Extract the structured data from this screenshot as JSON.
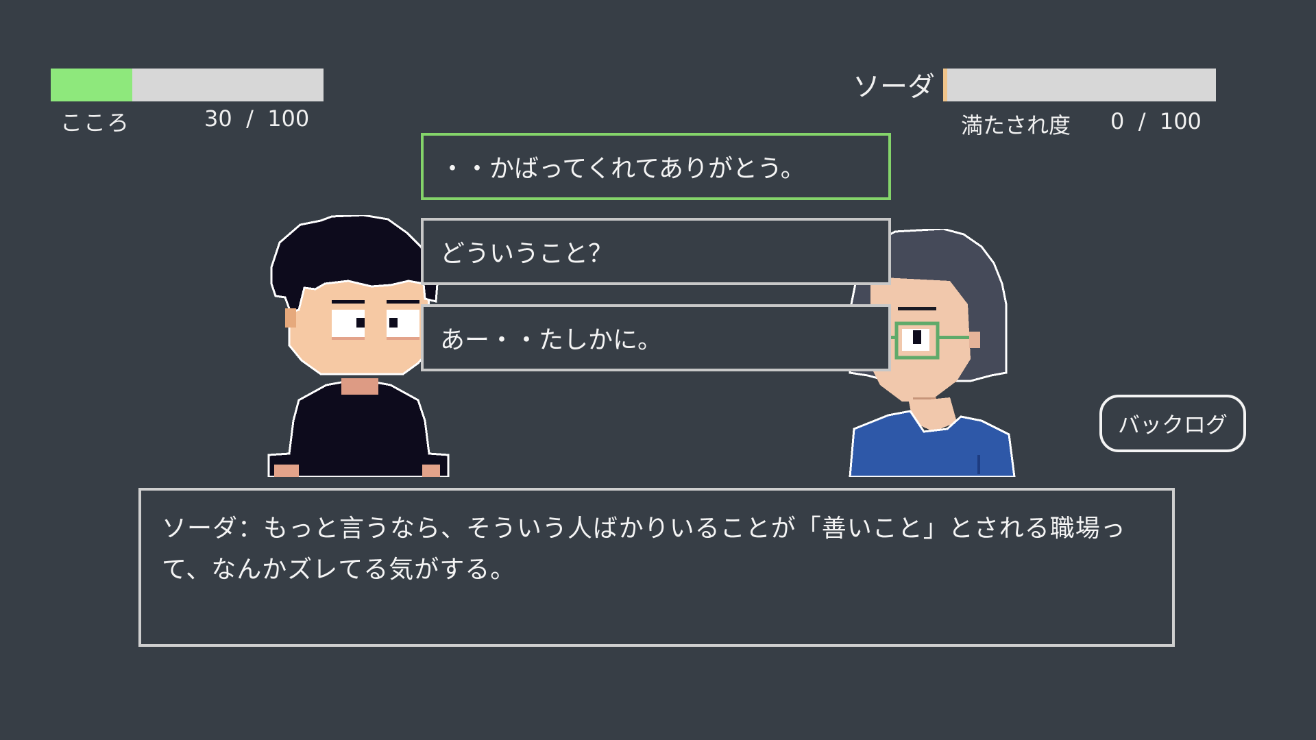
{
  "colors": {
    "background": "#373e46",
    "kokoro_fill": "#8ee87c",
    "gauge_track": "#d7d7d7",
    "soda_fill": "#f0c48a",
    "selected_border": "#84d46a",
    "panel_border": "#c8c8c8"
  },
  "hud": {
    "kokoro": {
      "label": "こころ",
      "value_text": "30  /  100",
      "value": 30,
      "max": 100
    },
    "soda": {
      "name": "ソーダ",
      "label": "満たされ度",
      "value_text": "0  /  100",
      "value": 0,
      "max": 100
    }
  },
  "choices": [
    {
      "text": "・・かばってくれてありがとう。",
      "selected": true
    },
    {
      "text": "どういうこと？",
      "selected": false
    },
    {
      "text": "あー・・たしかに。",
      "selected": false
    }
  ],
  "backlog_label": "バックログ",
  "dialogue": {
    "text": "ソーダ：もっと言うなら、そういう人ばかりいることが「善いこと」とされる職場って、なんかズレてる気がする。"
  },
  "icons": {
    "left_character": "player-character-sprite",
    "right_character": "soda-character-sprite"
  }
}
